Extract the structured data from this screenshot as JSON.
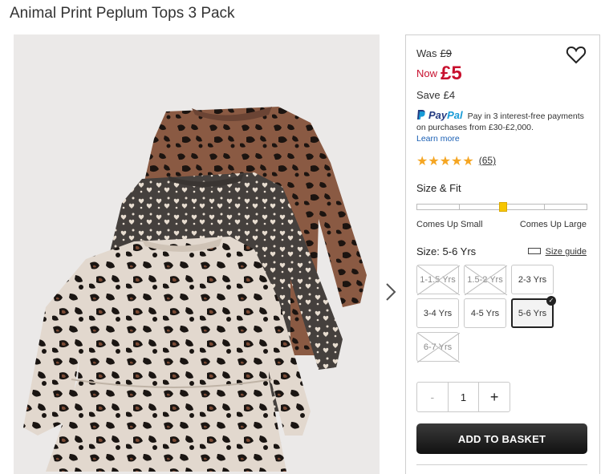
{
  "product": {
    "title": "Animal Print Peplum Tops 3 Pack"
  },
  "price": {
    "was_label": "Was",
    "was_value": "£9",
    "now_label": "Now",
    "now_value": "£5",
    "save_label": "Save",
    "save_value": "£4",
    "now_color": "#c8102e"
  },
  "paypal": {
    "logo_pay": "Pay",
    "logo_pal": "Pal",
    "text_1": "Pay in 3 interest-free payments",
    "text_2": "on purchases from £30-£2,000.",
    "link": "Learn more"
  },
  "rating": {
    "stars": 5,
    "stars_text": "★★★★★",
    "count": "(65)"
  },
  "fit": {
    "label": "Size & Fit",
    "left": "Comes Up Small",
    "right": "Comes Up Large",
    "position": 0.5
  },
  "size": {
    "label": "Size: 5-6 Yrs",
    "guide": "Size guide",
    "options": [
      {
        "label": "1-1.5 Yrs",
        "available": false
      },
      {
        "label": "1.5-2 Yrs",
        "available": false
      },
      {
        "label": "2-3 Yrs",
        "available": true
      },
      {
        "label": "3-4 Yrs",
        "available": true
      },
      {
        "label": "4-5 Yrs",
        "available": true
      },
      {
        "label": "5-6 Yrs",
        "available": true,
        "selected": true
      },
      {
        "label": "6-7 Yrs",
        "available": false
      }
    ]
  },
  "quantity": {
    "minus": "-",
    "value": "1",
    "plus": "+"
  },
  "actions": {
    "add_to_basket": "ADD TO BASKET"
  },
  "icons": {
    "wishlist": "heart-icon",
    "next": "chevron-right-icon",
    "size_guide": "ruler-icon",
    "selected": "check-icon"
  }
}
